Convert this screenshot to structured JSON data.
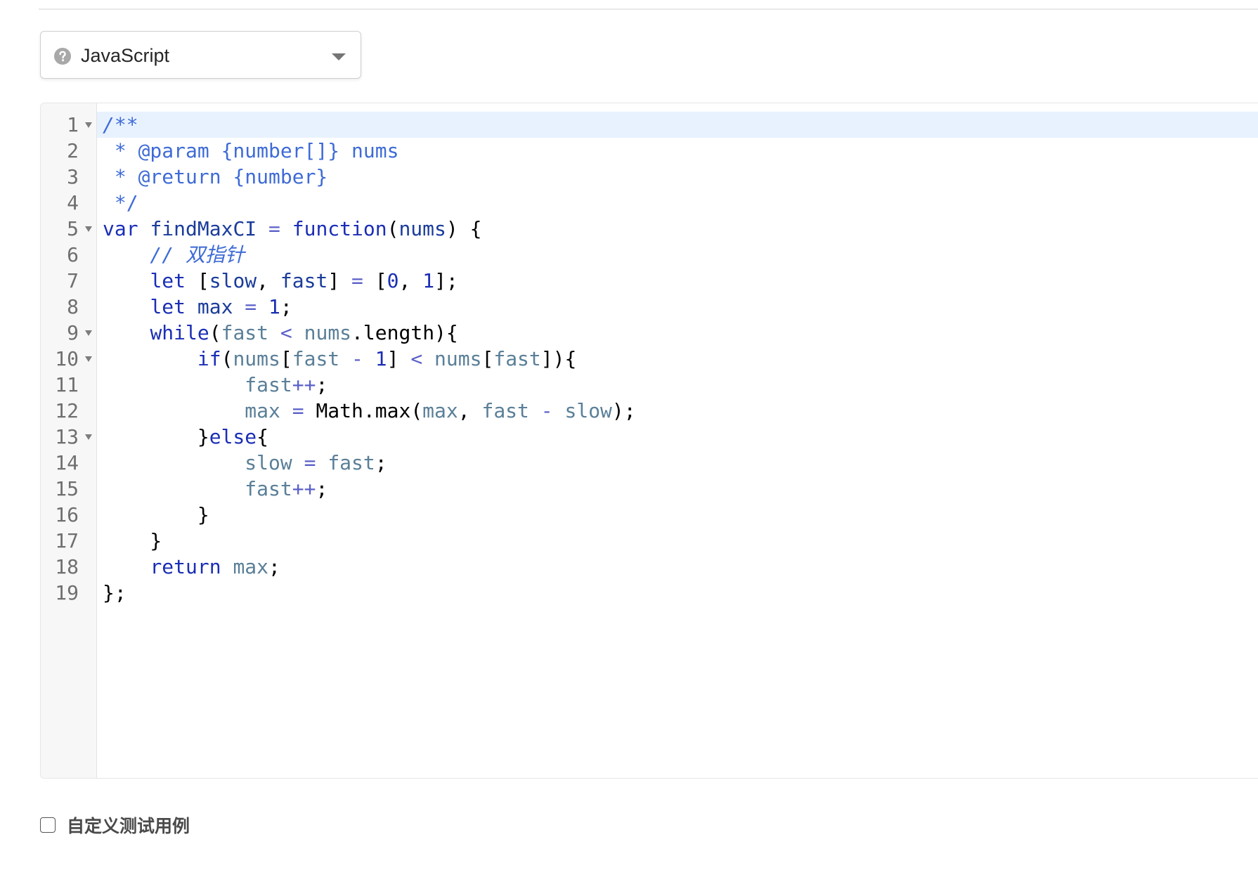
{
  "language_select": {
    "selected": "JavaScript",
    "help_icon": "question-circle-icon",
    "dropdown_icon": "caret-down-icon"
  },
  "editor": {
    "active_line": 1,
    "fold_lines": [
      1,
      5,
      9,
      10,
      13
    ],
    "line_numbers": [
      "1",
      "2",
      "3",
      "4",
      "5",
      "6",
      "7",
      "8",
      "9",
      "10",
      "11",
      "12",
      "13",
      "14",
      "15",
      "16",
      "17",
      "18",
      "19"
    ],
    "lines": [
      [
        {
          "t": "/**",
          "c": "cm"
        }
      ],
      [
        {
          "t": " * @param {number[]} nums",
          "c": "cmu"
        }
      ],
      [
        {
          "t": " * @return {number}",
          "c": "cmu"
        }
      ],
      [
        {
          "t": " */",
          "c": "cmu"
        }
      ],
      [
        {
          "t": "var",
          "c": "kw"
        },
        {
          "t": " ",
          "c": "pl"
        },
        {
          "t": "findMaxCI",
          "c": "vd"
        },
        {
          "t": " = ",
          "c": "op"
        },
        {
          "t": "function",
          "c": "kw"
        },
        {
          "t": "(",
          "c": "pl"
        },
        {
          "t": "nums",
          "c": "vd"
        },
        {
          "t": ") {",
          "c": "pl"
        }
      ],
      [
        {
          "t": "    // 双指针",
          "c": "cm"
        }
      ],
      [
        {
          "t": "    ",
          "c": "pl"
        },
        {
          "t": "let",
          "c": "kw"
        },
        {
          "t": " [",
          "c": "pl"
        },
        {
          "t": "slow",
          "c": "vd"
        },
        {
          "t": ", ",
          "c": "pl"
        },
        {
          "t": "fast",
          "c": "vd"
        },
        {
          "t": "] ",
          "c": "pl"
        },
        {
          "t": "=",
          "c": "op"
        },
        {
          "t": " [",
          "c": "pl"
        },
        {
          "t": "0",
          "c": "nm"
        },
        {
          "t": ", ",
          "c": "pl"
        },
        {
          "t": "1",
          "c": "nm"
        },
        {
          "t": "];",
          "c": "pl"
        }
      ],
      [
        {
          "t": "    ",
          "c": "pl"
        },
        {
          "t": "let",
          "c": "kw"
        },
        {
          "t": " ",
          "c": "pl"
        },
        {
          "t": "max",
          "c": "vd"
        },
        {
          "t": " = ",
          "c": "op"
        },
        {
          "t": "1",
          "c": "nm"
        },
        {
          "t": ";",
          "c": "pl"
        }
      ],
      [
        {
          "t": "    ",
          "c": "pl"
        },
        {
          "t": "while",
          "c": "kw"
        },
        {
          "t": "(",
          "c": "pl"
        },
        {
          "t": "fast",
          "c": "vr"
        },
        {
          "t": " < ",
          "c": "op"
        },
        {
          "t": "nums",
          "c": "vr"
        },
        {
          "t": ".length){",
          "c": "pl"
        }
      ],
      [
        {
          "t": "        ",
          "c": "pl"
        },
        {
          "t": "if",
          "c": "kw"
        },
        {
          "t": "(",
          "c": "pl"
        },
        {
          "t": "nums",
          "c": "vr"
        },
        {
          "t": "[",
          "c": "pl"
        },
        {
          "t": "fast",
          "c": "vr"
        },
        {
          "t": " - ",
          "c": "op"
        },
        {
          "t": "1",
          "c": "nm"
        },
        {
          "t": "] ",
          "c": "pl"
        },
        {
          "t": "<",
          "c": "op"
        },
        {
          "t": " ",
          "c": "pl"
        },
        {
          "t": "nums",
          "c": "vr"
        },
        {
          "t": "[",
          "c": "pl"
        },
        {
          "t": "fast",
          "c": "vr"
        },
        {
          "t": "]){",
          "c": "pl"
        }
      ],
      [
        {
          "t": "            ",
          "c": "pl"
        },
        {
          "t": "fast",
          "c": "vr"
        },
        {
          "t": "++",
          "c": "op"
        },
        {
          "t": ";",
          "c": "pl"
        }
      ],
      [
        {
          "t": "            ",
          "c": "pl"
        },
        {
          "t": "max",
          "c": "vr"
        },
        {
          "t": " = ",
          "c": "op"
        },
        {
          "t": "Math.max(",
          "c": "pl"
        },
        {
          "t": "max",
          "c": "vr"
        },
        {
          "t": ", ",
          "c": "pl"
        },
        {
          "t": "fast",
          "c": "vr"
        },
        {
          "t": " - ",
          "c": "op"
        },
        {
          "t": "slow",
          "c": "vr"
        },
        {
          "t": ");",
          "c": "pl"
        }
      ],
      [
        {
          "t": "        }",
          "c": "pl"
        },
        {
          "t": "else",
          "c": "kw"
        },
        {
          "t": "{",
          "c": "pl"
        }
      ],
      [
        {
          "t": "            ",
          "c": "pl"
        },
        {
          "t": "slow",
          "c": "vr"
        },
        {
          "t": " = ",
          "c": "op"
        },
        {
          "t": "fast",
          "c": "vr"
        },
        {
          "t": ";",
          "c": "pl"
        }
      ],
      [
        {
          "t": "            ",
          "c": "pl"
        },
        {
          "t": "fast",
          "c": "vr"
        },
        {
          "t": "++",
          "c": "op"
        },
        {
          "t": ";",
          "c": "pl"
        }
      ],
      [
        {
          "t": "        }",
          "c": "pl"
        }
      ],
      [
        {
          "t": "    }",
          "c": "pl"
        }
      ],
      [
        {
          "t": "    ",
          "c": "pl"
        },
        {
          "t": "return",
          "c": "kw"
        },
        {
          "t": " ",
          "c": "pl"
        },
        {
          "t": "max",
          "c": "vr"
        },
        {
          "t": ";",
          "c": "pl"
        }
      ],
      [
        {
          "t": "};",
          "c": "pl"
        }
      ]
    ]
  },
  "custom_testcase": {
    "label": "自定义测试用例",
    "checked": false
  }
}
